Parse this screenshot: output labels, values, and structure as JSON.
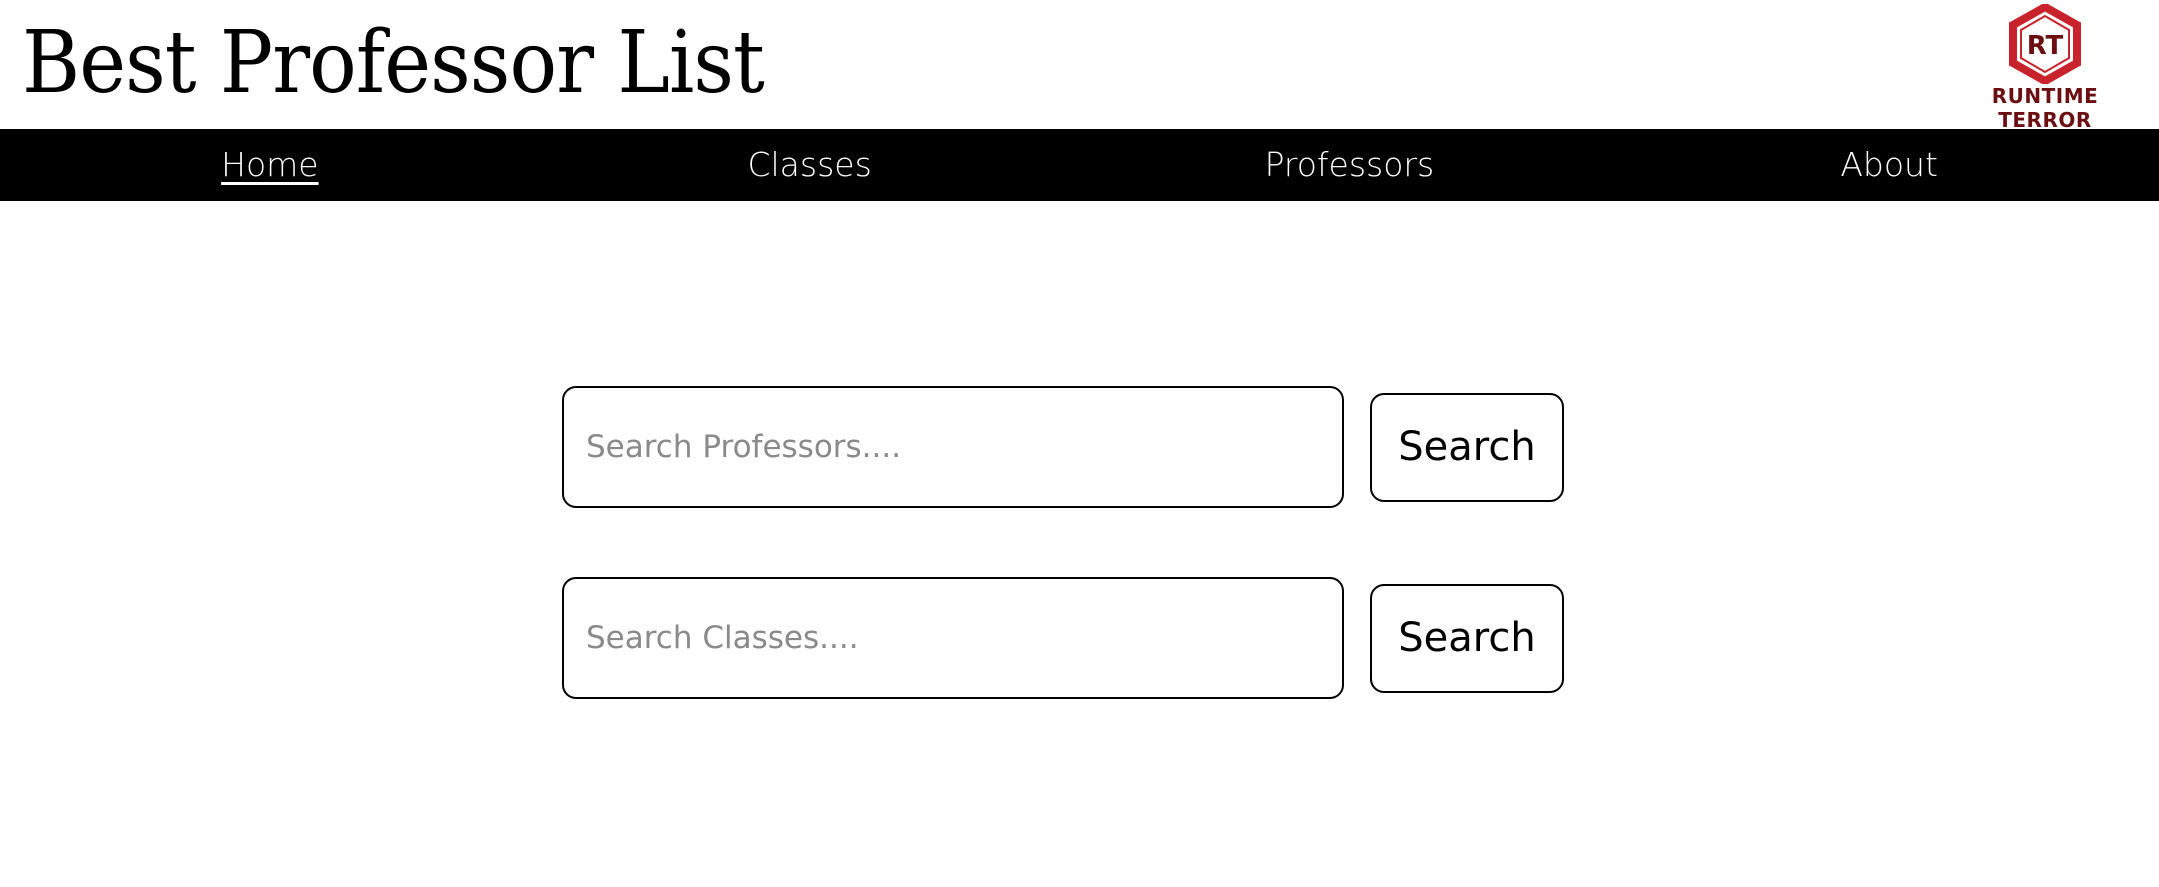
{
  "header": {
    "title": "Best Professor List",
    "logo": {
      "monogram": "RT",
      "text": "RUNTIME TERROR",
      "colors": {
        "hexagon": "#c8232c",
        "text": "#6b0f12"
      }
    }
  },
  "nav": {
    "items": [
      {
        "label": "Home",
        "active": true
      },
      {
        "label": "Classes",
        "active": false
      },
      {
        "label": "Professors",
        "active": false
      },
      {
        "label": "About",
        "active": false
      }
    ]
  },
  "search": [
    {
      "placeholder": "Search Professors....",
      "value": "",
      "button_label": "Search"
    },
    {
      "placeholder": "Search Classes....",
      "value": "",
      "button_label": "Search"
    }
  ]
}
